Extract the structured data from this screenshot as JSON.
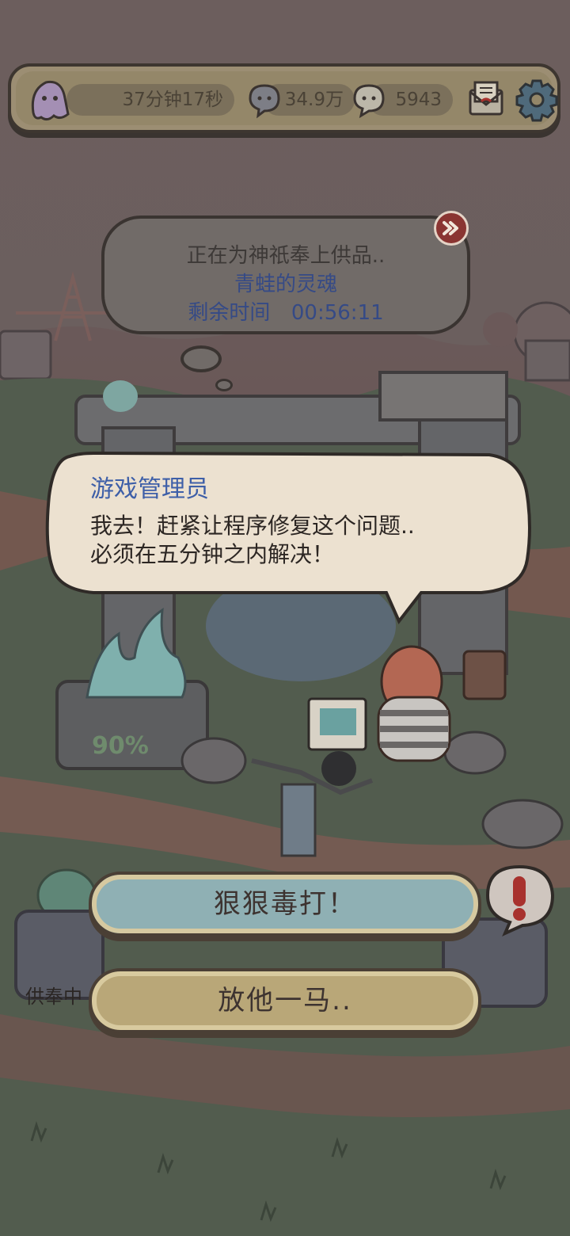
{
  "topbar": {
    "timer": "37分钟17秒",
    "souls": "34.9万",
    "messages": "5943",
    "icons": [
      "ghost-icon",
      "chat-bubble-icon",
      "speech-bubble-icon",
      "mail-icon",
      "gear-icon"
    ]
  },
  "offering": {
    "status": "正在为神祇奉上供品..",
    "item": "青蛙的灵魂",
    "time_label": "剩余时间",
    "time_value": "00:56:11"
  },
  "dialog": {
    "speaker": "游戏管理员",
    "line1": "我去！赶紧让程序修复这个问题..",
    "line2": "必须在五分钟之内解决！"
  },
  "altar": {
    "progress": "90%",
    "status_label": "供奉中"
  },
  "choices": {
    "beat": "狠狠毒打！",
    "spare": "放他一马.."
  },
  "colors": {
    "bar_bg": "#948769",
    "name_blue": "#3e5fa8",
    "beat_button": "#8fb0b4",
    "spare_button": "#b9a778",
    "alert_red": "#a8322e"
  }
}
